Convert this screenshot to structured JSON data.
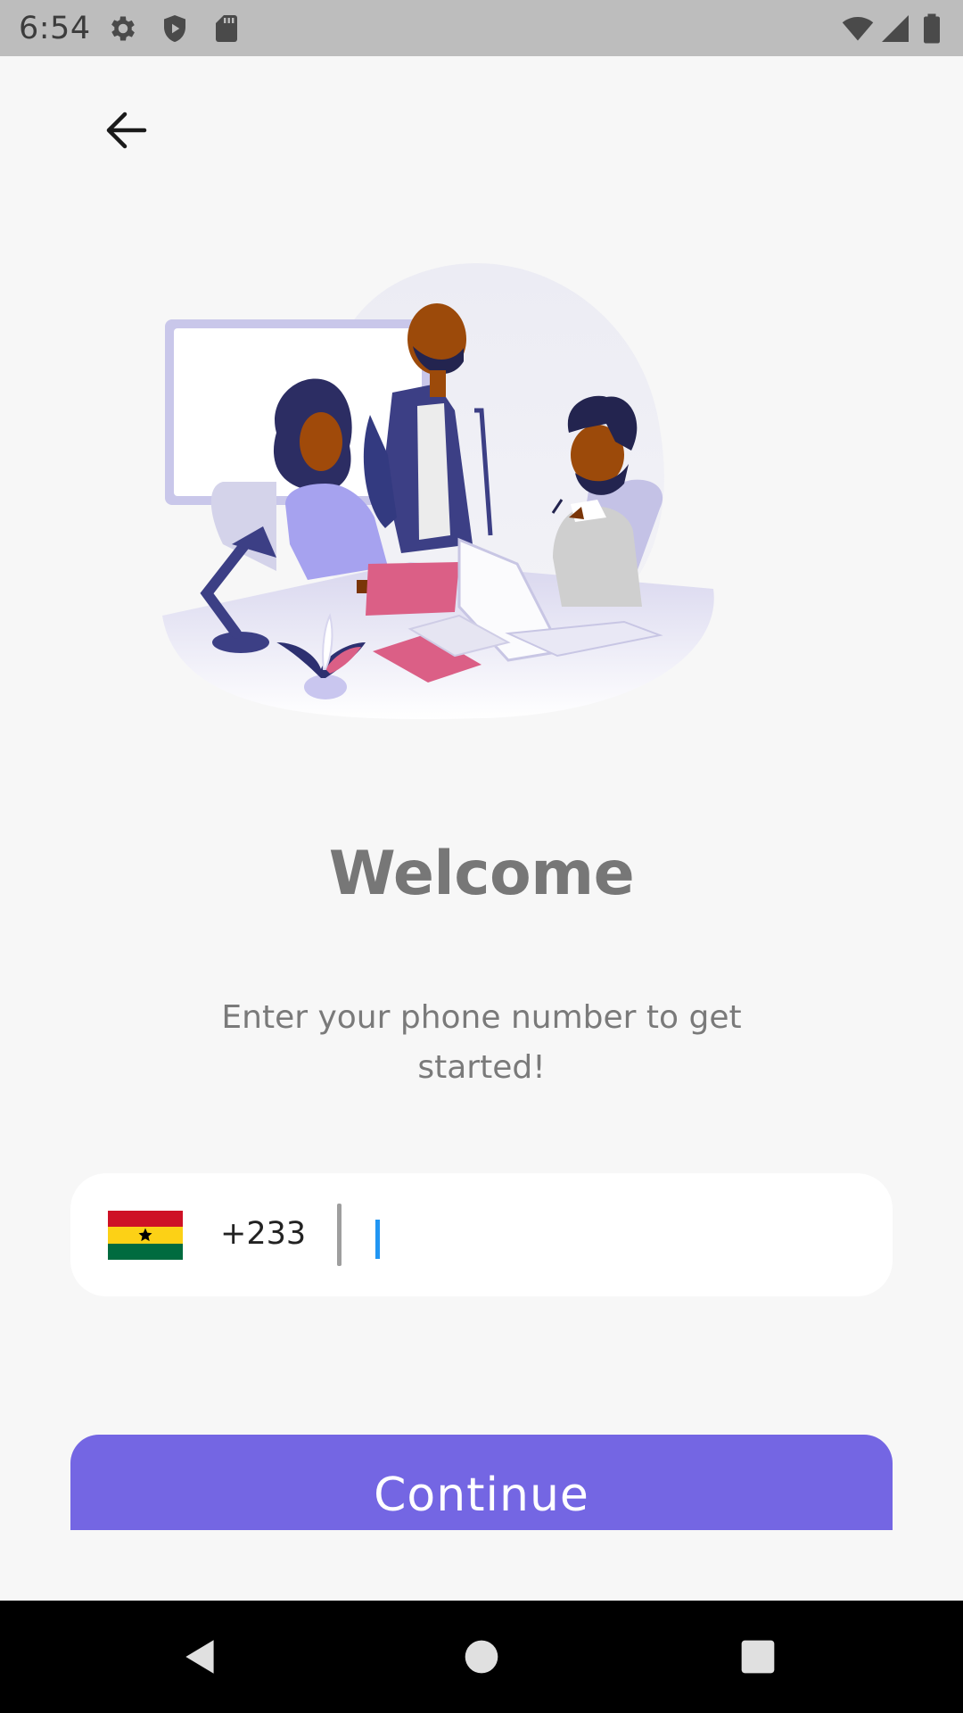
{
  "status_bar": {
    "time": "6:54",
    "icons": [
      "gear-icon",
      "shield-icon",
      "sd-card-icon",
      "wifi-icon",
      "signal-icon",
      "battery-icon"
    ]
  },
  "nav": {
    "back_icon": "arrow-left-icon"
  },
  "illustration": {
    "icon": "team-meeting-illustration"
  },
  "welcome": {
    "title": "Welcome",
    "subtitle": "Enter your phone number to get started!"
  },
  "phone": {
    "country_flag": "ghana-flag-icon",
    "dial_code": "+233",
    "value": "",
    "placeholder": ""
  },
  "actions": {
    "continue_label": "Continue"
  },
  "colors": {
    "accent": "#7466e3",
    "background": "#f7f7f7",
    "caret": "#2196f3"
  },
  "system_nav": {
    "icons": [
      "back-triangle-icon",
      "home-circle-icon",
      "recents-square-icon"
    ]
  }
}
